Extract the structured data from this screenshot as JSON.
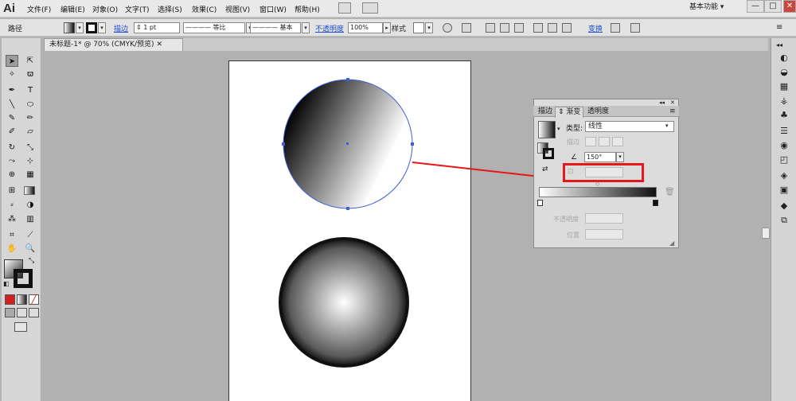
{
  "app": {
    "logo": "Ai"
  },
  "menu": [
    "文件(F)",
    "编辑(E)",
    "对象(O)",
    "文字(T)",
    "选择(S)",
    "效果(C)",
    "视图(V)",
    "窗口(W)",
    "帮助(H)"
  ],
  "workspace": {
    "label": "基本功能"
  },
  "window_buttons": {
    "minimize": "—",
    "maximize": "□",
    "close": "✕"
  },
  "control": {
    "selection_label": "路径",
    "stroke_label": "描边",
    "stroke_weight": "1 pt",
    "profile1": "等比",
    "profile2": "基本",
    "opacity_label": "不透明度",
    "opacity_value": "100%",
    "style_label": "样式",
    "transform_label": "变换"
  },
  "document": {
    "tab_title": "未标题-1* @ 70% (CMYK/预览)"
  },
  "gradient_panel": {
    "tabs": [
      "描边",
      "渐变",
      "透明度"
    ],
    "active_tab": "渐变",
    "type_label": "类型",
    "type_value": "线性",
    "stroke_label": "描边",
    "angle_value": "150°",
    "opacity_label": "不透明度",
    "location_label": "位置"
  },
  "colors": {
    "highlight": "#e8161b",
    "selection_blue": "#3f5ed9",
    "close_red": "#c9483d"
  }
}
